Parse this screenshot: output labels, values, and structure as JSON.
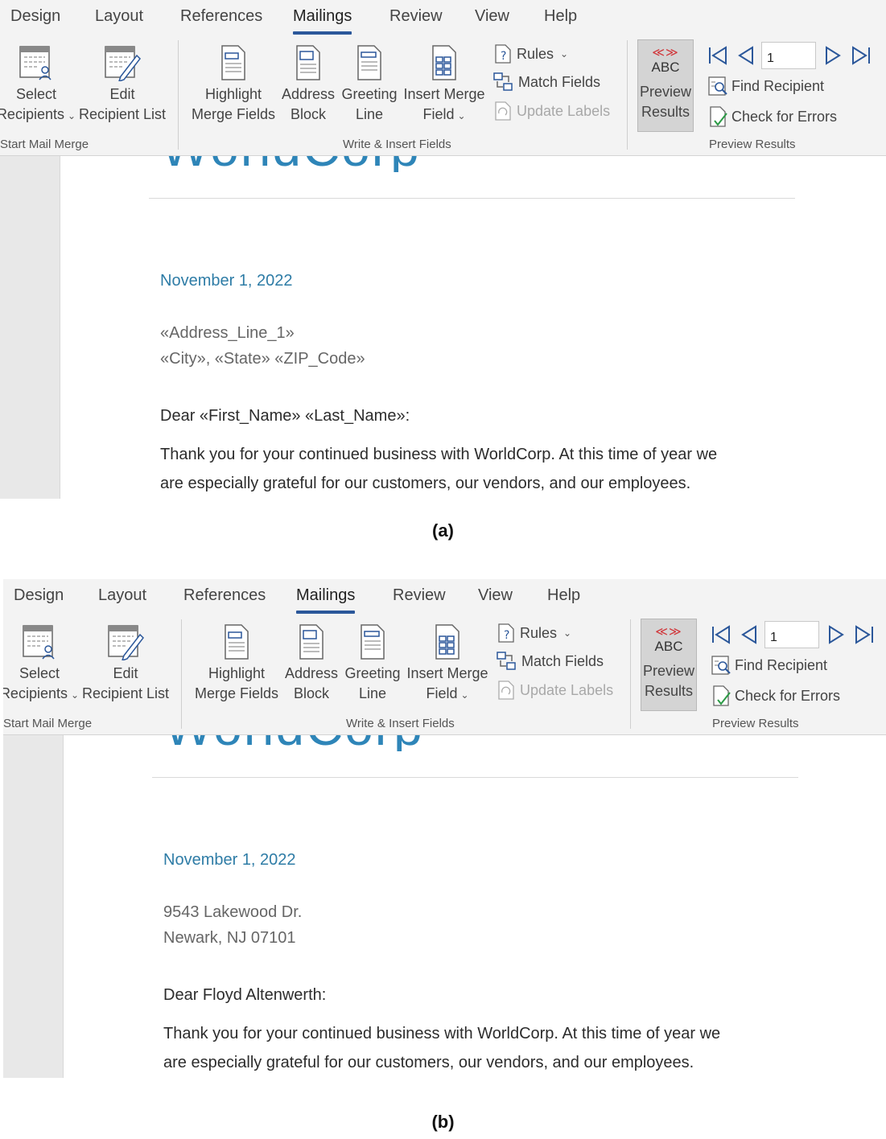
{
  "tabs": [
    "Design",
    "Layout",
    "References",
    "Mailings",
    "Review",
    "View",
    "Help"
  ],
  "ribbon": {
    "start_group": "Start Mail Merge",
    "select_recipients": {
      "line1": "Select",
      "line2": "Recipients"
    },
    "edit_list": {
      "line1": "Edit",
      "line2": "Recipient List"
    },
    "write_group": "Write & Insert Fields",
    "highlight": {
      "line1": "Highlight",
      "line2": "Merge Fields"
    },
    "address_block": {
      "line1": "Address",
      "line2": "Block"
    },
    "greeting_line": {
      "line1": "Greeting",
      "line2": "Line"
    },
    "insert_merge": {
      "line1": "Insert Merge",
      "line2": "Field"
    },
    "rules": "Rules",
    "match_fields": "Match Fields",
    "update_labels": "Update Labels",
    "preview_group": "Preview Results",
    "preview_arrows": "≪≫",
    "preview_abc": "ABC",
    "preview_results": {
      "line1": "Preview",
      "line2": "Results"
    },
    "record_value": "1",
    "find_recipient": "Find Recipient",
    "check_errors": "Check for Errors"
  },
  "logo_text": "WorldCorp",
  "panel_a": {
    "date": "November 1, 2022",
    "address_line1": "«Address_Line_1»",
    "address_line2": "«City», «State»  «ZIP_Code»",
    "salutation": "Dear «First_Name» «Last_Name»:",
    "body_line1": "Thank you for your continued business with WorldCorp.  At this time of year we",
    "body_line2": "are especially grateful for our customers, our vendors, and our employees.",
    "caption": "(a)"
  },
  "panel_b": {
    "date": "November 1, 2022",
    "address_line1": "9543 Lakewood Dr.",
    "address_line2": "Newark, NJ  07101",
    "salutation": "Dear Floyd Altenwerth:",
    "body_line1": "Thank you for your continued business with WorldCorp.  At this time of year we",
    "body_line2": "are especially grateful for our customers, our vendors, and our employees.",
    "caption": "(b)"
  }
}
